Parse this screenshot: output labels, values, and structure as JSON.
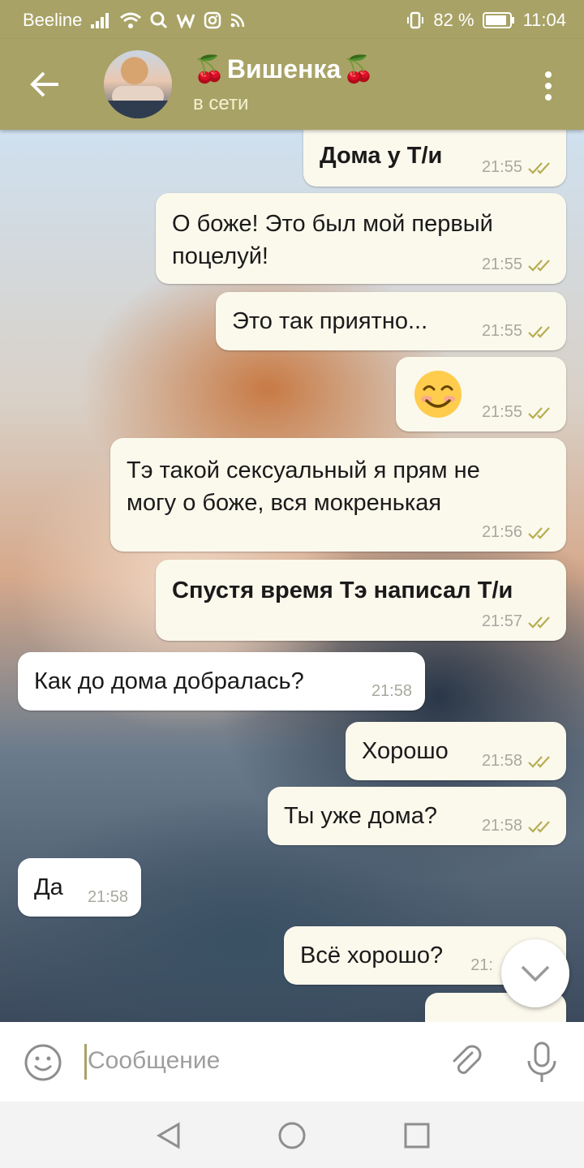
{
  "status_bar": {
    "carrier": "Beeline",
    "battery": "82 %",
    "time": "11:04"
  },
  "chat_header": {
    "name": "Вишенка",
    "name_emoji": "🍒",
    "status": "в сети"
  },
  "messages": [
    {
      "text": "Дома у Т/и",
      "time": "21:55",
      "outgoing": true,
      "bold": true
    },
    {
      "text": "О боже! Это был мой первый поцелуй!",
      "line1": "О боже! Это был мой первый",
      "line2": "поцелуй!",
      "time": "21:55",
      "outgoing": true
    },
    {
      "text": "Это так приятно...",
      "time": "21:55",
      "outgoing": true
    },
    {
      "emoji": "smiling-face",
      "time": "21:55",
      "outgoing": true
    },
    {
      "text": "Тэ такой сексуальный я прям не могу о боже, вся мокренькая",
      "line1": "Тэ такой сексуальный я прям не",
      "line2": "могу о боже, вся мокренькая",
      "time": "21:56",
      "outgoing": true
    },
    {
      "text": "Спустя время Тэ написал Т/и",
      "time": "21:57",
      "outgoing": true,
      "bold": true
    },
    {
      "text": "Как до дома добралась?",
      "time": "21:58",
      "outgoing": false
    },
    {
      "text": "Хорошо",
      "time": "21:58",
      "outgoing": true
    },
    {
      "text": "Ты уже дома?",
      "time": "21:58",
      "outgoing": true
    },
    {
      "text": "Да",
      "time": "21:58",
      "outgoing": false
    },
    {
      "text": "Всё хорошо?",
      "time": "21:",
      "outgoing": true
    }
  ],
  "composer": {
    "placeholder": "Сообщение"
  },
  "colors": {
    "accent": "#a8a266",
    "bubble_out": "#fbf8ec",
    "bubble_in": "#ffffff",
    "check": "#b6ad52"
  }
}
